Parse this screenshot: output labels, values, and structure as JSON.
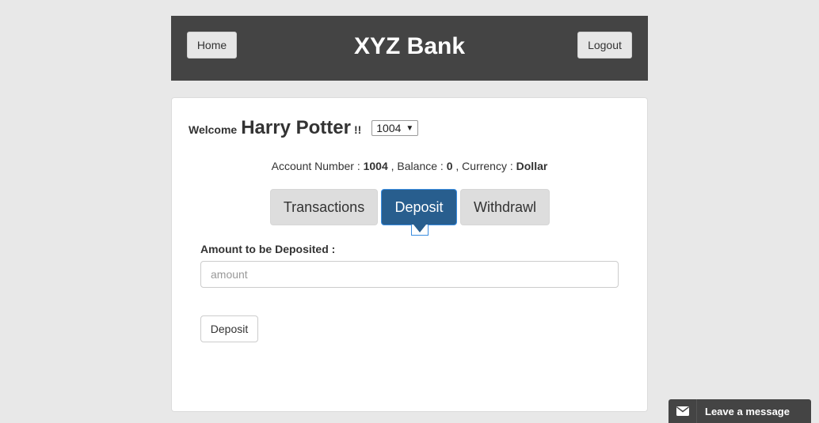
{
  "header": {
    "home_label": "Home",
    "title": "XYZ Bank",
    "logout_label": "Logout"
  },
  "welcome": {
    "prefix": "Welcome",
    "customer_name": "Harry Potter",
    "suffix": "!!",
    "selected_account": "1004"
  },
  "account_info": {
    "account_number_label": "Account Number :",
    "account_number": "1004",
    "balance_label": ", Balance :",
    "balance": "0",
    "currency_label": ", Currency :",
    "currency": "Dollar"
  },
  "tabs": [
    {
      "label": "Transactions",
      "active": false
    },
    {
      "label": "Deposit",
      "active": true
    },
    {
      "label": "Withdrawl",
      "active": false
    }
  ],
  "deposit_form": {
    "amount_label": "Amount to be Deposited :",
    "amount_value": "",
    "amount_placeholder": "amount",
    "submit_label": "Deposit"
  },
  "chat": {
    "icon": "envelope-icon",
    "label": "Leave a message"
  },
  "colors": {
    "header_bg": "#444444",
    "active_tab_bg": "#285e8e",
    "page_bg": "#e8e8e8"
  }
}
